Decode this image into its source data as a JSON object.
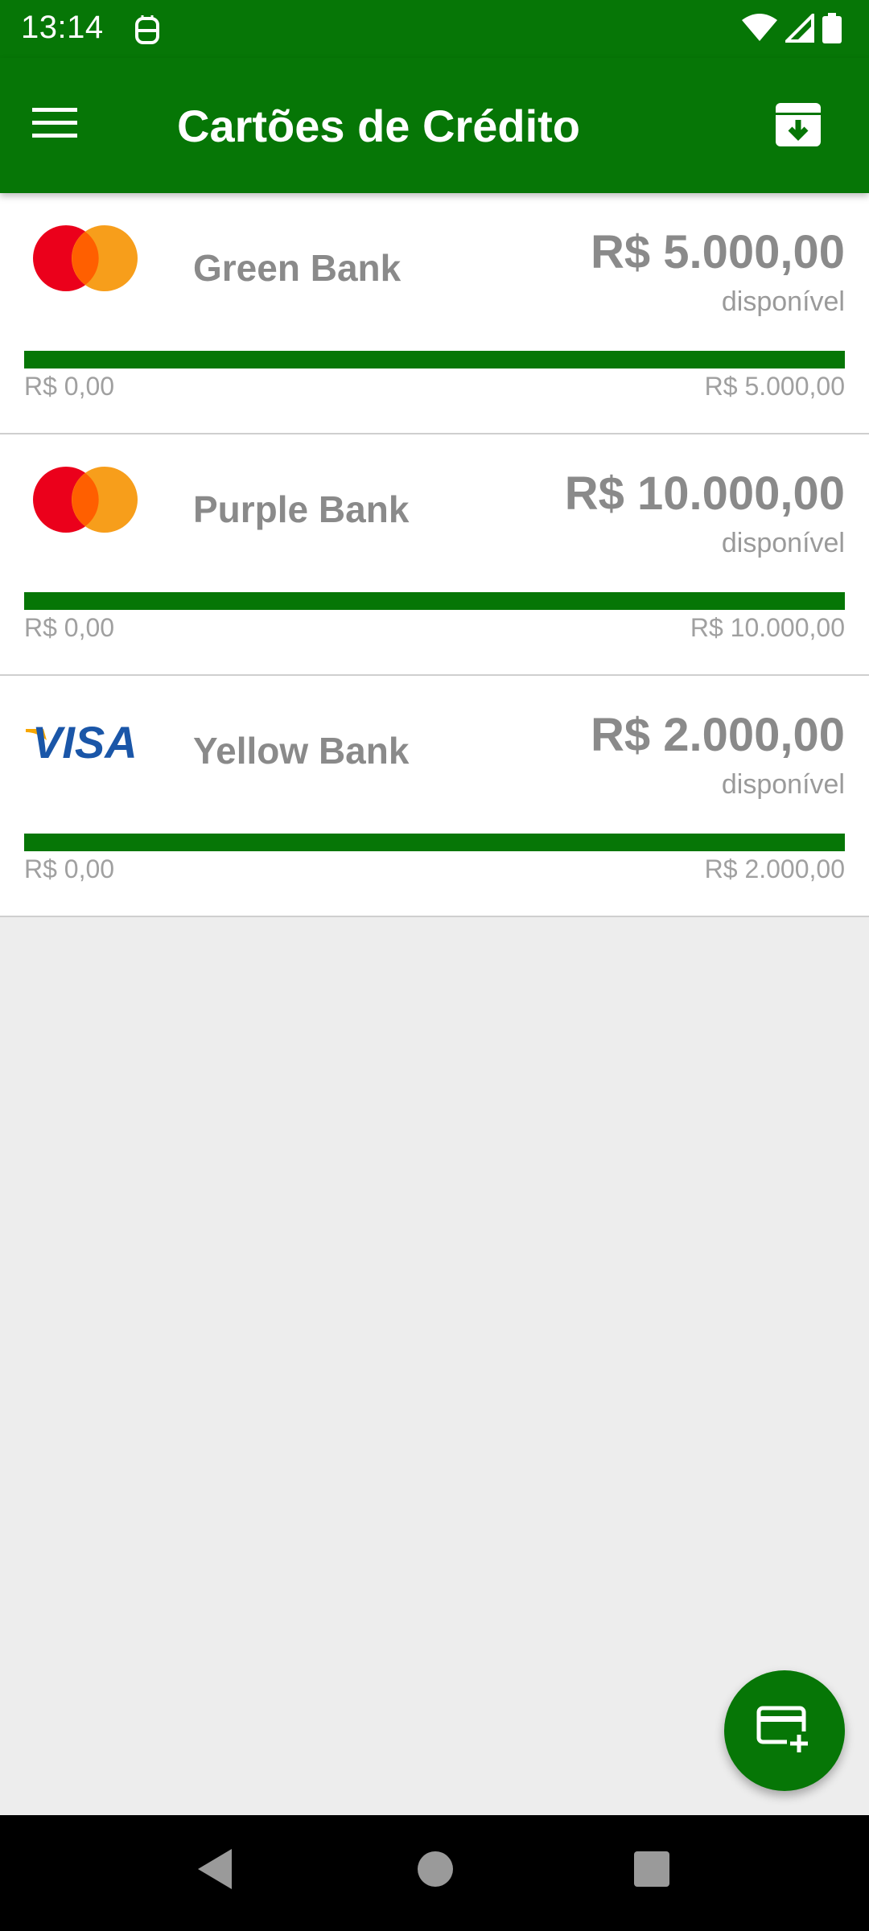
{
  "status_bar": {
    "time": "13:14",
    "icons": [
      "app-notification-icon",
      "wifi-icon",
      "signal-icon",
      "battery-icon"
    ]
  },
  "app_bar": {
    "title": "Cartões de Crédito",
    "menu_icon": "hamburger-menu-icon",
    "action_icon": "archive-icon"
  },
  "cards": [
    {
      "brand": "mastercard",
      "bank": "Green Bank",
      "available": "R$ 5.000,00",
      "available_label": "disponível",
      "min": "R$ 0,00",
      "max": "R$ 5.000,00",
      "available_fraction": 1.0
    },
    {
      "brand": "mastercard",
      "bank": "Purple Bank",
      "available": "R$ 10.000,00",
      "available_label": "disponível",
      "min": "R$ 0,00",
      "max": "R$ 10.000,00",
      "available_fraction": 1.0
    },
    {
      "brand": "visa",
      "bank": "Yellow Bank",
      "available": "R$ 2.000,00",
      "available_label": "disponível",
      "min": "R$ 0,00",
      "max": "R$ 2.000,00",
      "available_fraction": 1.0,
      "brand_text": "VISA"
    }
  ],
  "fab": {
    "icon": "add-card-icon"
  },
  "nav": {
    "icons": [
      "back-icon",
      "home-icon",
      "recents-icon"
    ]
  },
  "colors": {
    "primary": "#067606",
    "text_gray": "#8a8a8a",
    "background": "#ededed"
  }
}
